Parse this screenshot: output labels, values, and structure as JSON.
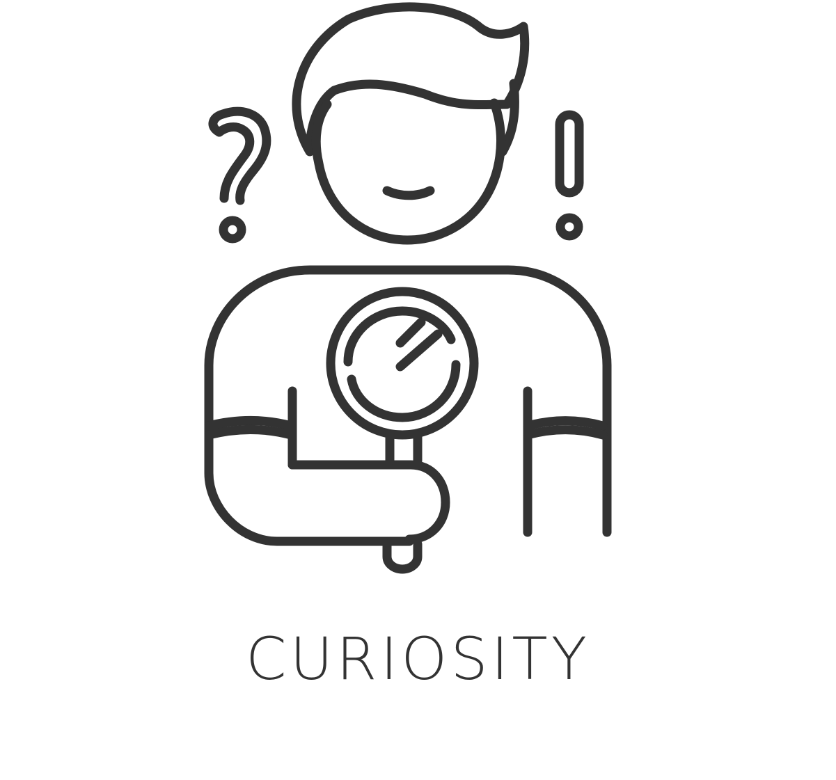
{
  "caption": {
    "text": "CURIOSITY"
  },
  "icon": {
    "name": "curious-person-with-magnifier-icon",
    "stroke_color": "#333333",
    "background_color": "#ffffff",
    "symbols": [
      "question-mark-icon",
      "exclamation-mark-icon",
      "magnifying-glass-icon"
    ]
  }
}
